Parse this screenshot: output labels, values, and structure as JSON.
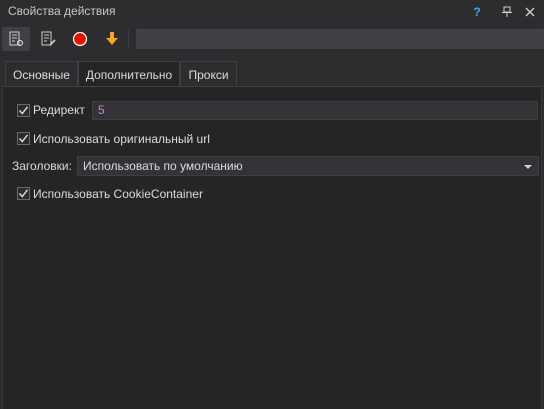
{
  "window": {
    "title": "Свойства действия",
    "help_glyph": "?",
    "pin_glyph": "⊥",
    "close_glyph": "✕"
  },
  "toolbar": {
    "icons": [
      "properties-icon",
      "edit-properties-icon",
      "record-icon",
      "download-arrow-icon"
    ],
    "field_value": ""
  },
  "tabs": {
    "items": [
      "Основные",
      "Дополнительно",
      "Прокси"
    ],
    "active": 1
  },
  "options": {
    "redirect": {
      "label": "Редирект",
      "checked": true,
      "value": "5"
    },
    "original_url": {
      "label": "Использовать оригинальный url",
      "checked": true
    },
    "headers": {
      "label": "Заголовки:",
      "selected": "Использовать по умолчанию"
    },
    "cookie_container": {
      "label": "Использовать CookieContainer",
      "checked": true
    }
  },
  "colors": {
    "background": "#2d2d30",
    "panel": "#252526",
    "input_background": "#333337",
    "accent_red": "#e51400",
    "accent_orange": "#f5a623",
    "value_text": "#c586c0"
  }
}
